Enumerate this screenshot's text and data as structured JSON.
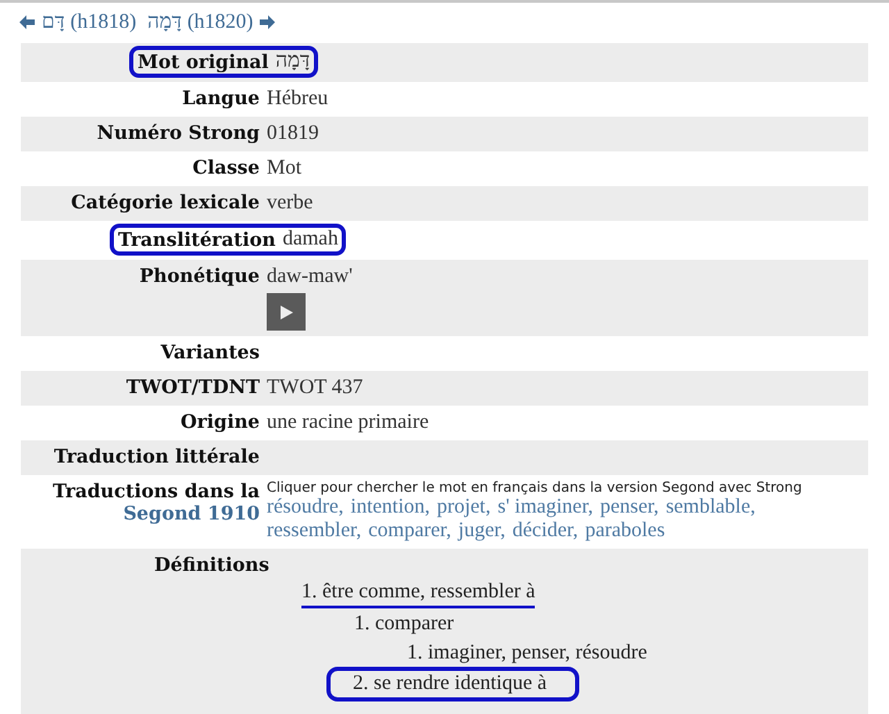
{
  "nav": {
    "prev": {
      "word": "דָּם",
      "code": "(h1818)"
    },
    "next": {
      "word": "דָּמָה",
      "code": "(h1820)"
    }
  },
  "rows": [
    {
      "kind": "text",
      "label": "Mot original",
      "value": "דָּמָה",
      "highlighted": true
    },
    {
      "kind": "text",
      "label": "Langue",
      "value": "Hébreu",
      "highlighted": false
    },
    {
      "kind": "text",
      "label": "Numéro Strong",
      "value": "01819",
      "highlighted": false
    },
    {
      "kind": "text",
      "label": "Classe",
      "value": "Mot",
      "highlighted": false
    },
    {
      "kind": "text",
      "label": "Catégorie lexicale",
      "value": "verbe",
      "highlighted": false
    },
    {
      "kind": "text",
      "label": "Translitération",
      "value": "damah",
      "highlighted": true
    },
    {
      "kind": "audio",
      "label": "Phonétique",
      "value": "daw-maw'",
      "highlighted": false
    },
    {
      "kind": "text",
      "label": "Variantes",
      "highlighted": false
    },
    {
      "kind": "text",
      "label": "TWOT/TDNT",
      "value": "TWOT 437",
      "highlighted": false
    },
    {
      "kind": "text",
      "label": "Origine",
      "value": "une racine primaire",
      "highlighted": false
    },
    {
      "kind": "text",
      "label": "Traduction littérale",
      "highlighted": false
    },
    {
      "kind": "translations",
      "label": "Traductions dans la",
      "label_link": "Segond 1910",
      "hint": "Cliquer pour chercher le mot en français dans la version Segond avec Strong",
      "words": [
        "résoudre,",
        "intention,",
        "projet,",
        "s' imaginer,",
        "penser,",
        "semblable,",
        "ressembler,",
        "comparer,",
        "juger,",
        "décider,",
        "paraboles"
      ]
    },
    {
      "kind": "definitions",
      "label": "Définitions",
      "items": [
        {
          "text": "1. être comme, ressembler à",
          "underlined": true,
          "boxed": false,
          "children": [
            {
              "text": "1. comparer",
              "underlined": false,
              "boxed": false,
              "children": [
                {
                  "text": "1. imaginer, penser, résoudre",
                  "underlined": false,
                  "boxed": false
                }
              ]
            },
            {
              "text": "2. se rendre identique à",
              "underlined": false,
              "boxed": true
            }
          ]
        }
      ]
    }
  ]
}
